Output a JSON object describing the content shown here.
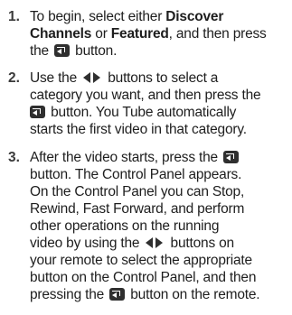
{
  "steps": [
    {
      "number": "1.",
      "line1": "To begin, select either ",
      "line1_bold": "Discover",
      "line2_bold_a": "Channels",
      "line2_mid": " or ",
      "line2_bold_b": "Featured",
      "line2_end": ", and then press",
      "line3_a": "the ",
      "line3_b": " button."
    },
    {
      "number": "2.",
      "line1_a": "Use the ",
      "line1_b": " buttons to select a",
      "line2": "category you want, and then press the",
      "line3": " button. You Tube automatically",
      "line4": "starts the first video in that category."
    },
    {
      "number": "3.",
      "line1": "After the video starts, press the ",
      "line2": "button. The Control Panel appears.",
      "line3": "On the Control Panel you can Stop,",
      "line4": "Rewind, Fast Forward, and perform",
      "line5": "other operations on the running",
      "line6_a": "video by using the ",
      "line6_b": " buttons on",
      "line7": "your remote to select the appropriate",
      "line8": "button on the Control Panel, and then",
      "line9_a": "pressing the ",
      "line9_b": " button on the remote."
    }
  ],
  "icons": {
    "enter": "enter-button-icon",
    "left_right": "left-right-arrow-icon"
  }
}
